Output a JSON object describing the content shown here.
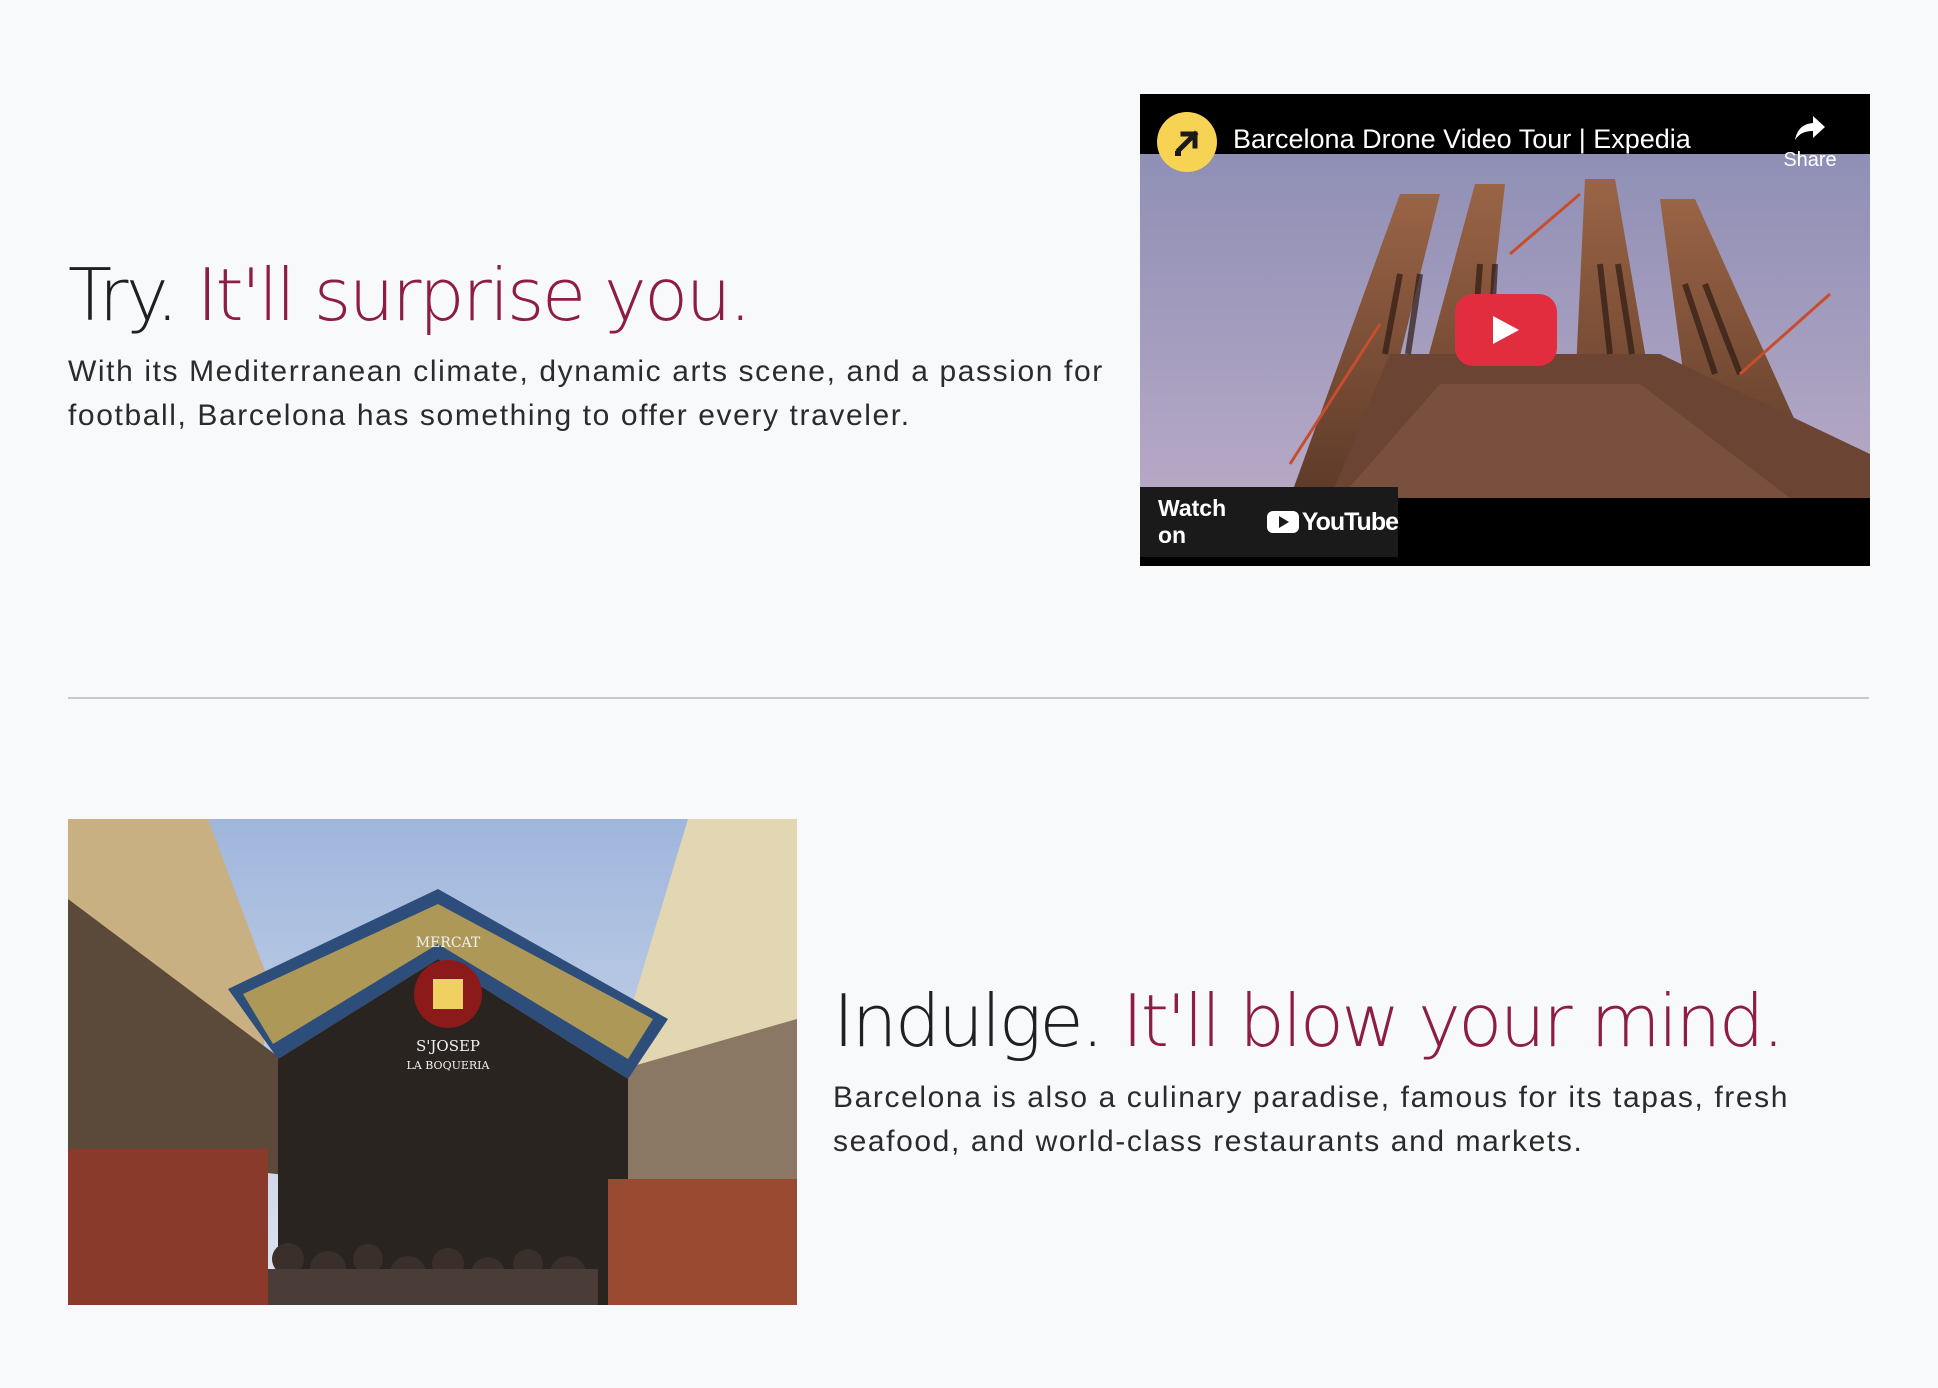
{
  "section_try": {
    "headline_lead": "Try.",
    "headline_accent": "It'll surprise you.",
    "body": "With its Mediterranean climate, dynamic arts scene, and a passion for football, Barcelona has something to offer every traveler."
  },
  "video": {
    "title": "Barcelona Drone Video Tour | Expedia",
    "share_label": "Share",
    "watch_on_label": "Watch on",
    "youtube_label": "YouTube",
    "channel_logo_icon": "expedia-arrow-icon",
    "play_icon": "play-icon",
    "colors": {
      "play_button": "#e22d3f",
      "channel_logo": "#f6d353"
    }
  },
  "section_indulge": {
    "headline_lead": "Indulge.",
    "headline_accent": "It'll blow your mind.",
    "body": "Barcelona is also a culinary paradise, famous for its tapas, fresh seafood, and world-class restaurants and markets.",
    "image_sign_top": "MERCAT",
    "image_sign_mid": "S'JOSEP",
    "image_sign_bottom": "LA BOQUERIA"
  },
  "theme": {
    "accent": "#8e1d46",
    "background": "#f8f9fb",
    "text": "#202020"
  }
}
